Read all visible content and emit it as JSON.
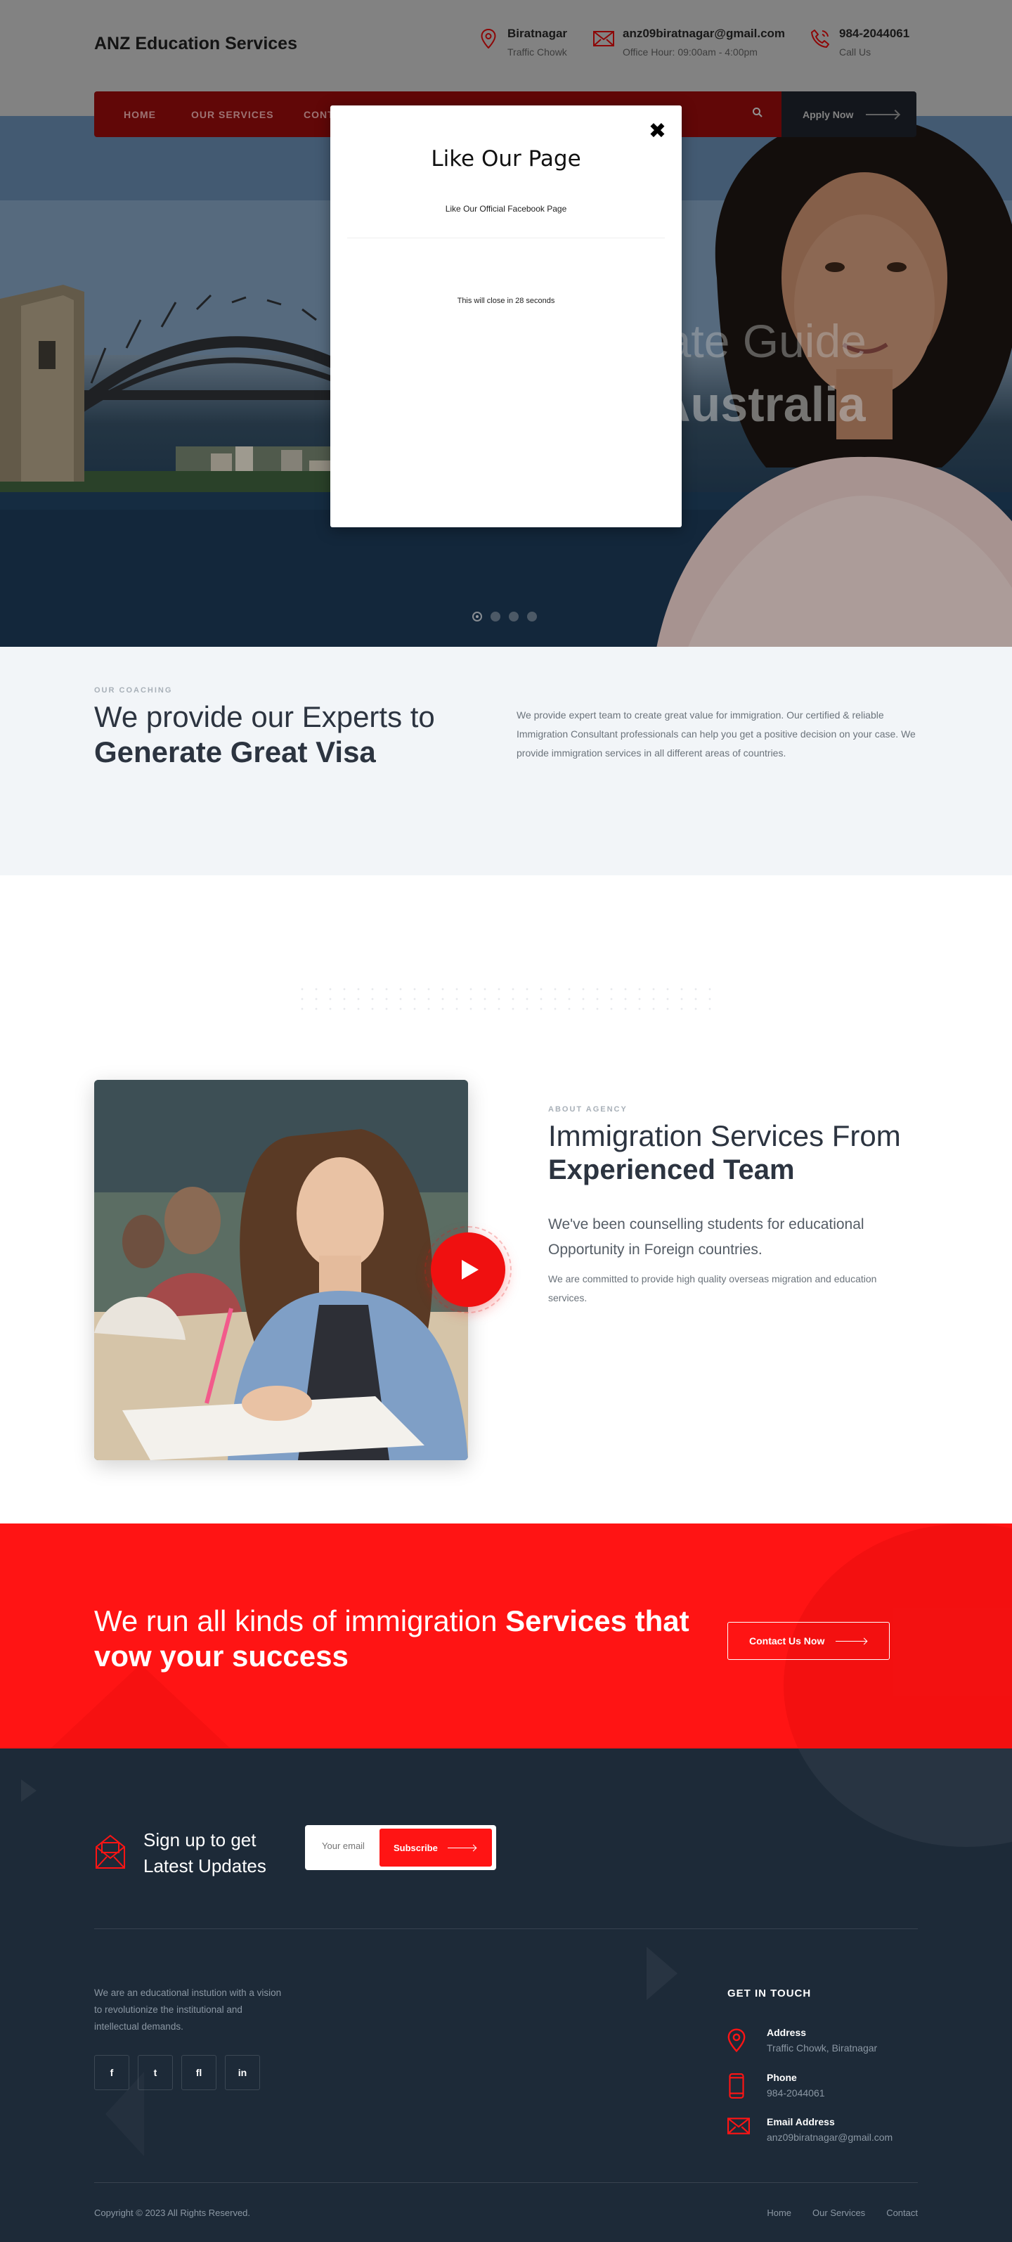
{
  "header": {
    "brand": "ANZ Education Services",
    "location": {
      "title": "Biratnagar",
      "sub": "Traffic Chowk"
    },
    "email": {
      "title": "anz09biratnagar@gmail.com",
      "sub": "Office Hour: 09:00am - 4:00pm"
    },
    "phone": {
      "title": "984-2044061",
      "sub": "Call Us"
    }
  },
  "nav": {
    "items": [
      "HOME",
      "OUR SERVICES",
      "CONT"
    ],
    "apply_label": "Apply Now"
  },
  "hero": {
    "title_line1": "iate Guide",
    "title_line2": "Australia",
    "slides": 4,
    "active_slide": 1
  },
  "popup": {
    "title": "Like Our Page",
    "subtitle": "Like Our Official Facebook Page",
    "timer": "This will close in 28 seconds",
    "close_glyph": "✖"
  },
  "coaching": {
    "kicker": "OUR COACHING",
    "heading_light": "We provide our Experts to",
    "heading_bold": "Generate Great Visa",
    "body": "We provide expert team to create great value for immigration. Our certified & reliable Immigration Consultant professionals can help you get a positive decision on your case. We provide immigration services in all different areas of countries."
  },
  "about": {
    "kicker": "ABOUT AGENCY",
    "heading_light": "Immigration Services From",
    "heading_bold": "Experienced Team",
    "lead": "We've been counselling students for educational Opportunity in Foreign countries.",
    "body": "We are committed to provide high quality overseas migration and education services."
  },
  "cta": {
    "text_light": "We run all kinds of immigration",
    "text_bold": "Services that vow your success",
    "button": "Contact Us Now"
  },
  "footer": {
    "newsletter_title": "Sign up to get Latest Updates",
    "email_placeholder": "Your email",
    "subscribe": "Subscribe",
    "about": "We are an educational instution with a vision to revolutionize the institutional and intellectual demands.",
    "socials": [
      "f",
      "t",
      "fl",
      "in"
    ],
    "get_in_touch": "GET IN TOUCH",
    "address_label": "Address",
    "address_value": "Traffic Chowk, Biratnagar",
    "phone_label": "Phone",
    "phone_value": "984-2044061",
    "email_label": "Email Address",
    "email_value": "anz09biratnagar@gmail.com",
    "copyright": "Copyright © 2023 All Rights Reserved.",
    "links": [
      "Home",
      "Our Services",
      "Contact"
    ]
  },
  "colors": {
    "accent": "#ff1414",
    "dark": "#1d2a38",
    "nav_dimmed": "#870a0a"
  }
}
